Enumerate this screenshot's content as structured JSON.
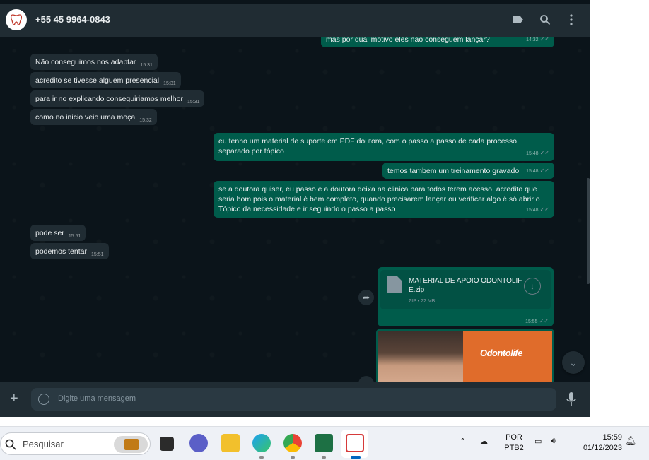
{
  "header": {
    "contact_name": "+55 45 9964-0843",
    "icons": [
      "label-icon",
      "search-icon",
      "menu-dots-icon"
    ]
  },
  "messages": [
    {
      "dir": "out",
      "text": "mas por qual motivo eles não conseguem lançar?",
      "time": "14:32"
    },
    {
      "dir": "in",
      "text": "Não conseguimos nos adaptar",
      "time": "15:31"
    },
    {
      "dir": "in",
      "text": "acredito se tivesse alguem presencial",
      "time": "15:31"
    },
    {
      "dir": "in",
      "text": "para ir no explicando conseguiriamos melhor",
      "time": "15:31"
    },
    {
      "dir": "in",
      "text": "como no inicio veio uma moça",
      "time": "15:32"
    },
    {
      "dir": "out",
      "text": "eu tenho um material de suporte em PDF doutora, com o passo a passo de cada processo separado por tópico",
      "time": "15:48"
    },
    {
      "dir": "out",
      "text": "temos tambem um treinamento gravado",
      "time": "15:48"
    },
    {
      "dir": "out",
      "text": "se a doutora quiser, eu passo e a doutora deixa na clinica para todos terem acesso, acredito que seria bom pois o material é bem completo, quando precisarem lançar ou verificar algo é só abrir o Tópico da necessidade e ir seguindo o passo a passo",
      "time": "15:48"
    },
    {
      "dir": "in",
      "text": "pode ser",
      "time": "15:51"
    },
    {
      "dir": "in",
      "text": "podemos tentar",
      "time": "15:51"
    }
  ],
  "file_message": {
    "name": "MATERIAL DE APOIO ODONTOLIFE.zip",
    "name_line1": "MATERIAL DE APOIO ODONTOLIF",
    "name_line2": "E.zip",
    "meta": "ZIP • 22 MB",
    "time": "15:55"
  },
  "image_message": {
    "logo": "Odontolife"
  },
  "composer": {
    "placeholder": "Digite uma mensagem"
  },
  "taskbar": {
    "search_placeholder": "Pesquisar",
    "lang_line1": "POR",
    "lang_line2": "PTB2",
    "time": "15:59",
    "date": "01/12/2023"
  },
  "colors": {
    "chat_bg": "#0b141a",
    "incoming_bubble": "#202c33",
    "outgoing_bubble": "#005c4b",
    "header_bg": "#202c33",
    "text": "#e9edef"
  }
}
